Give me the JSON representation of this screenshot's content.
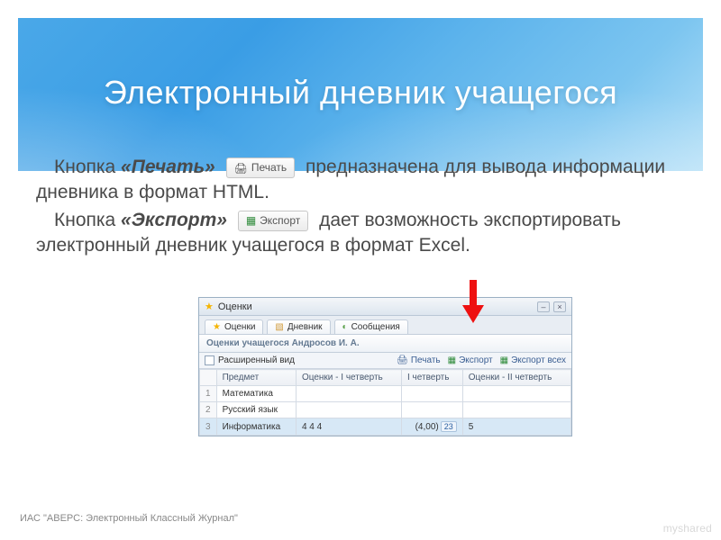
{
  "header": {
    "title": "Электронный дневник учащегося"
  },
  "body": {
    "p1_prefix": "Кнопка ",
    "p1_btn_label": "«Печать»",
    "p1_suffix": " предназначена для вывода информации дневника в формат HTML.",
    "p2_prefix": "Кнопка ",
    "p2_btn_label": "«Экспорт»",
    "p2_suffix": " дает возможность экспортировать электронный дневник учащегося в формат Excel.",
    "inline_btn_print": "Печать",
    "inline_btn_export": "Экспорт"
  },
  "screenshot": {
    "window_title": "Оценки",
    "tabs": {
      "grades": "Оценки",
      "diary": "Дневник",
      "messages": "Сообщения"
    },
    "subtitle": "Оценки учащегося Андросов И. А.",
    "toolbar": {
      "expanded_view": "Расширенный вид",
      "print": "Печать",
      "export": "Экспорт",
      "export_all": "Экспорт всех"
    },
    "table": {
      "col_subject": "Предмет",
      "col_grades_q1": "Оценки - I четверть",
      "col_q1": "I четверть",
      "col_grades_q2": "Оценки - II четверть",
      "row1_num": "1",
      "row1_subject": "Математика",
      "row2_num": "2",
      "row2_subject": "Русский язык",
      "row3_num": "3",
      "row3_subject": "Информатика",
      "row3_grades_q1": "4 4 4",
      "row3_avg": "(4,00)",
      "row3_avg_btn": "23",
      "row3_grades_q2": "5"
    }
  },
  "footer": "ИАС \"АВЕРС: Электронный Классный Журнал\"",
  "watermark": "myshared"
}
